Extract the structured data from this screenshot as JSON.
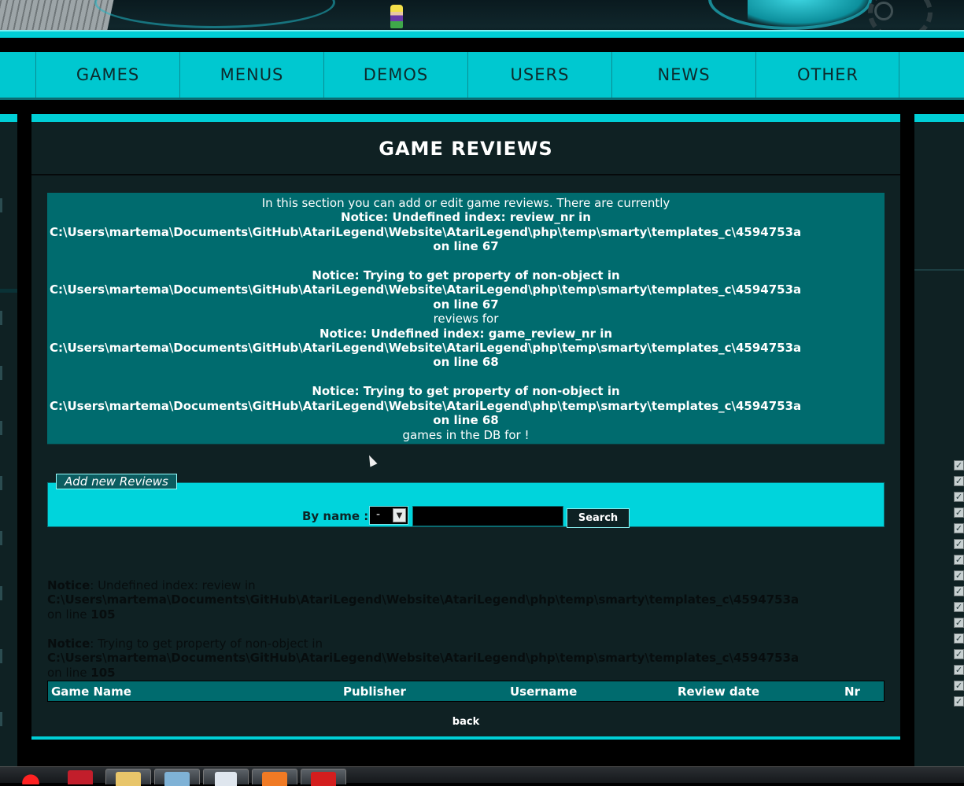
{
  "nav": {
    "items": [
      "GAMES",
      "MENUS",
      "DEMOS",
      "USERS",
      "NEWS",
      "OTHER"
    ]
  },
  "page": {
    "title": "GAME REVIEWS"
  },
  "notice_box": {
    "intro": "In this section you can add or edit game reviews. There are currently",
    "n1": "Notice: Undefined index: review_nr in",
    "path": "C:\\Users\\martema\\Documents\\GitHub\\AtariLegend\\Website\\AtariLegend\\php\\temp\\smarty\\templates_c\\4594753a",
    "line67": "on line 67",
    "n2": "Notice: Trying to get property of non-object in",
    "mid": "reviews for",
    "n3": "Notice: Undefined index: game_review_nr in",
    "line68": "on line 68",
    "outro": "games in the DB for !"
  },
  "add_reviews": {
    "legend": "Add new Reviews",
    "by_name_label": "By name :",
    "select_value": "-",
    "input_value": "",
    "search_button": "Search"
  },
  "lower_notices": {
    "notice_label": "Notice",
    "n1_text": ": Undefined index: review in",
    "n2_text": ": Trying to get property of non-object in",
    "path": "C:\\Users\\martema\\Documents\\GitHub\\AtariLegend\\Website\\AtariLegend\\php\\temp\\smarty\\templates_c\\4594753a",
    "line_prefix": "on line ",
    "line_number": "105"
  },
  "table": {
    "columns": [
      "Game Name",
      "Publisher",
      "Username",
      "Review date",
      "Nr"
    ]
  },
  "footer": {
    "back_label": "back"
  },
  "colors": {
    "accent": "#00cfd6",
    "panel": "#0f2123",
    "notice_bg": "#006b6e"
  },
  "taskbar": {
    "icons": [
      "opera-icon",
      "vivaldi-icon",
      "folder-icon",
      "editor-icon",
      "document-icon",
      "xampp-icon",
      "app-icon"
    ]
  }
}
